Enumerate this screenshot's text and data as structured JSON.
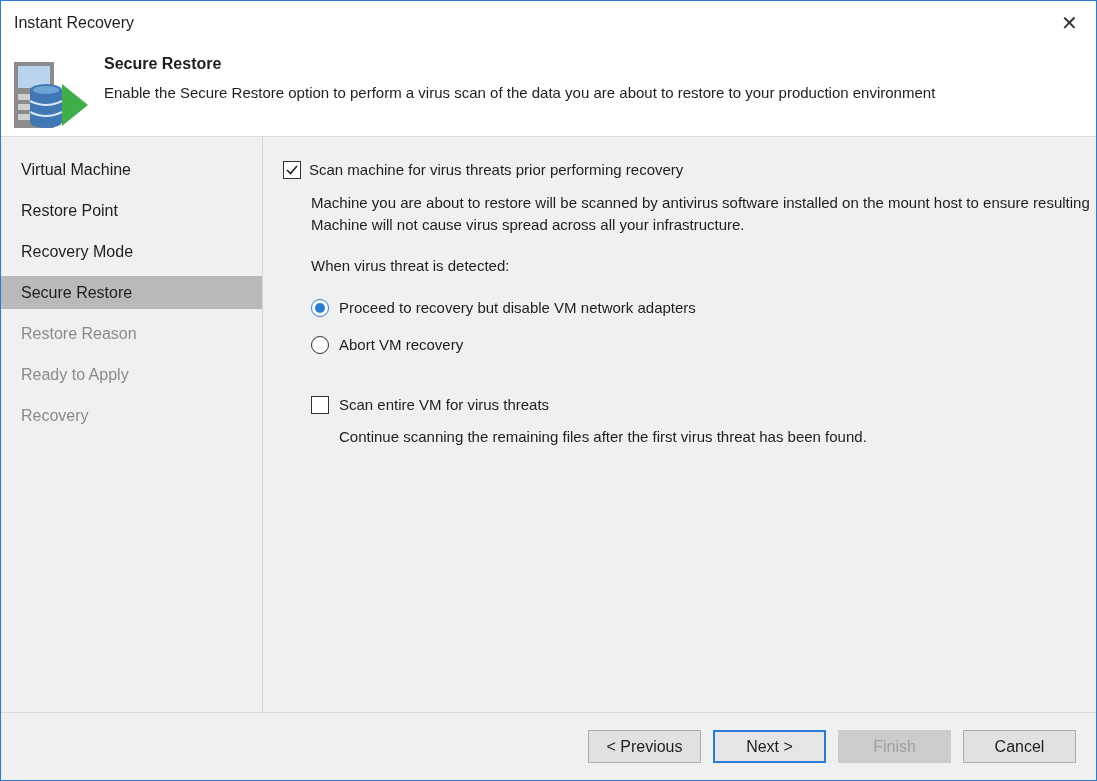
{
  "window": {
    "title": "Instant Recovery",
    "close": "✕"
  },
  "header": {
    "title": "Secure Restore",
    "description": "Enable the Secure Restore option to perform a virus scan of the data you are about to restore to your production environment"
  },
  "steps": [
    {
      "label": "Virtual Machine",
      "selected": false,
      "disabled": false
    },
    {
      "label": "Restore Point",
      "selected": false,
      "disabled": false
    },
    {
      "label": "Recovery Mode",
      "selected": false,
      "disabled": false
    },
    {
      "label": "Secure Restore",
      "selected": true,
      "disabled": false
    },
    {
      "label": "Restore Reason",
      "selected": false,
      "disabled": true
    },
    {
      "label": "Ready to Apply",
      "selected": false,
      "disabled": true
    },
    {
      "label": "Recovery",
      "selected": false,
      "disabled": true
    }
  ],
  "scan_option": {
    "label": "Scan machine for virus threats prior performing recovery",
    "checked": true,
    "description": "Machine you are about to restore will be scanned by antivirus software installed on the mount host to ensure resulting Machine will not cause virus spread across all your infrastructure."
  },
  "threat_label": "When virus threat is detected:",
  "threat_actions": [
    {
      "label": "Proceed to recovery but disable VM network adapters",
      "selected": true
    },
    {
      "label": "Abort VM recovery",
      "selected": false
    }
  ],
  "full_scan": {
    "label": "Scan entire VM for virus threats",
    "checked": false,
    "description": "Continue scanning the remaining files after the first virus threat has been found."
  },
  "buttons": [
    {
      "label": "< Previous",
      "default": false,
      "disabled": false
    },
    {
      "label": "Next >",
      "default": true,
      "disabled": false
    },
    {
      "label": "Finish",
      "default": false,
      "disabled": true
    },
    {
      "label": "Cancel",
      "default": false,
      "disabled": false
    }
  ]
}
